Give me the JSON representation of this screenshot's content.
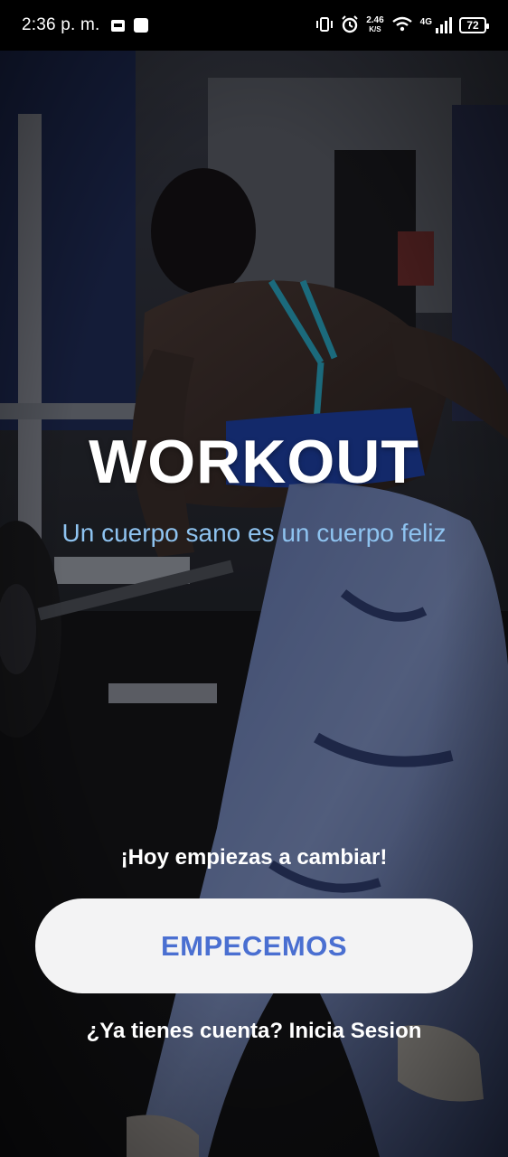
{
  "status_bar": {
    "time": "2:36 p. m.",
    "speed_value": "2.46",
    "speed_unit": "K/S",
    "network": "4G",
    "battery": "72"
  },
  "hero": {
    "title": "WORKOUT",
    "subtitle": "Un cuerpo sano es un cuerpo feliz"
  },
  "footer": {
    "tagline": "¡Hoy empiezas a cambiar!",
    "cta_label": "EMPECEMOS",
    "login_text": "¿Ya tienes cuenta? Inicia Sesion"
  },
  "colors": {
    "subtitle": "#8ec3f0",
    "cta_text": "#4a6fd1",
    "cta_bg": "#f3f3f4"
  },
  "icons": [
    "notification-icon",
    "app-icon",
    "vibrate-icon",
    "alarm-icon",
    "wifi-icon",
    "signal-icon",
    "battery-icon"
  ]
}
